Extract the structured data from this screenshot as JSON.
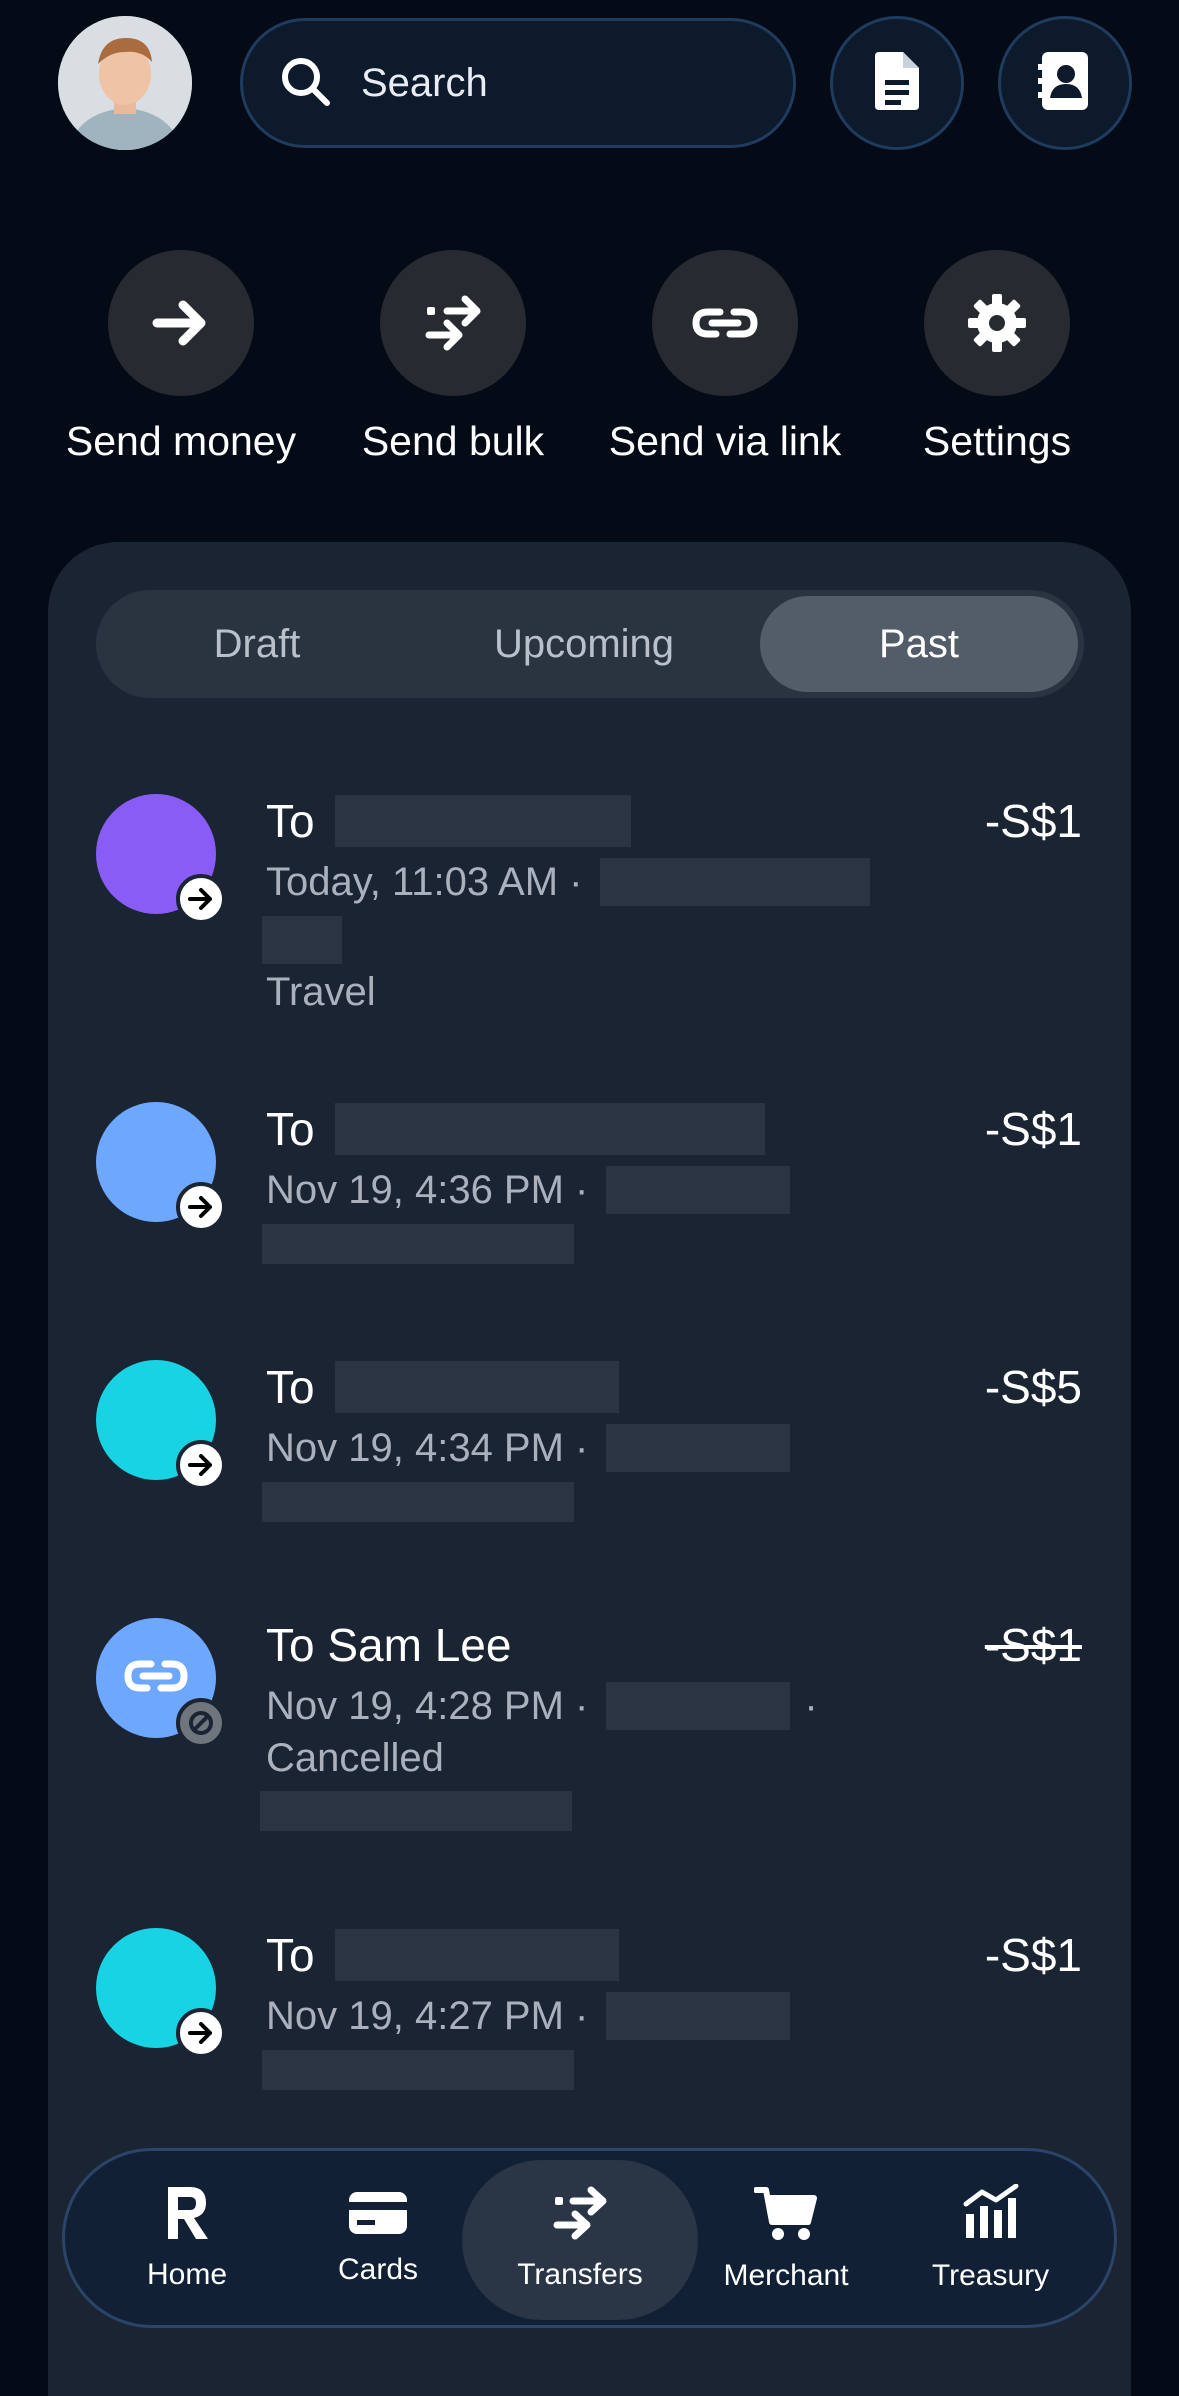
{
  "header": {
    "search_placeholder": "Search"
  },
  "quick_actions": [
    {
      "label": "Send money",
      "icon": "arrow-right-icon"
    },
    {
      "label": "Send bulk",
      "icon": "transfer-arrows-icon"
    },
    {
      "label": "Send via link",
      "icon": "link-icon"
    },
    {
      "label": "Settings",
      "icon": "gear-icon"
    }
  ],
  "tabs": {
    "items": [
      "Draft",
      "Upcoming",
      "Past"
    ],
    "active": "Past"
  },
  "transfers": [
    {
      "title": "To",
      "date": "Today, 11:03 AM ·",
      "status": "Travel",
      "amount": "-S$1",
      "color": "#8a5cf6",
      "badge": "arrow-right-icon"
    },
    {
      "title": "To",
      "date": "Nov 19, 4:36 PM ·",
      "status": "",
      "amount": "-S$1",
      "color": "#6ea8fe",
      "badge": "arrow-right-icon"
    },
    {
      "title": "To",
      "date": "Nov 19, 4:34 PM ·",
      "status": "",
      "amount": "-S$5",
      "color": "#18d3e3",
      "badge": "arrow-right-icon"
    },
    {
      "title": "To Sam Lee",
      "date": "Nov 19, 4:28 PM ·",
      "status": "Cancelled",
      "amount": "-S$1",
      "color": "#6ea8fe",
      "badge": "cancel-icon"
    },
    {
      "title": "To",
      "date": "Nov 19, 4:27 PM ·",
      "status": "",
      "amount": "-S$1",
      "color": "#18d3e3",
      "badge": "arrow-right-icon"
    }
  ],
  "bottom_nav": {
    "items": [
      "Home",
      "Cards",
      "Transfers",
      "Merchant",
      "Treasury"
    ],
    "active": "Transfers"
  }
}
